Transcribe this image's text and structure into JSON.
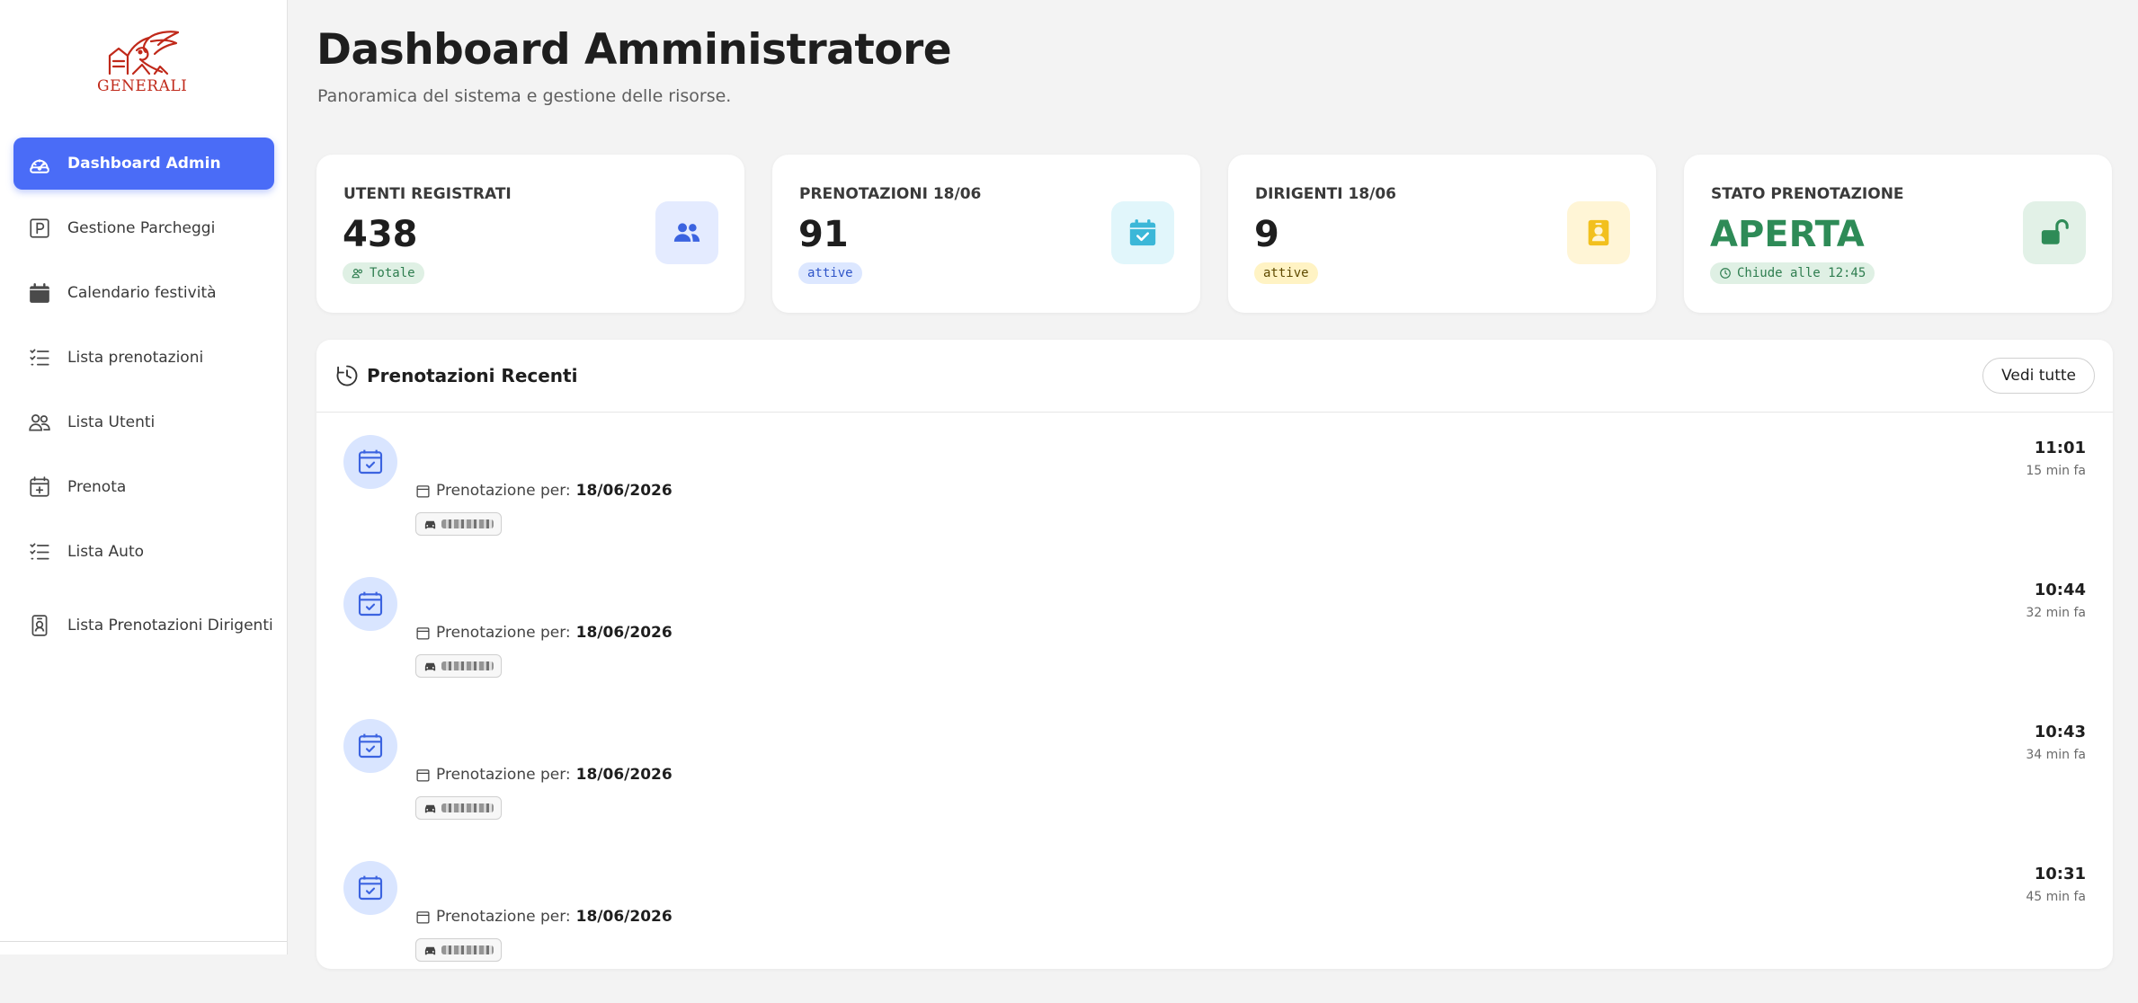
{
  "brand": {
    "logo_text": "GENERALI",
    "color": "#c0291a"
  },
  "sidebar": {
    "items": [
      {
        "label": "Dashboard Admin",
        "icon": "speedometer-icon",
        "active": true
      },
      {
        "label": "Gestione Parcheggi",
        "icon": "parking-icon",
        "active": false
      },
      {
        "label": "Calendario festività",
        "icon": "calendar-icon",
        "active": false
      },
      {
        "label": "Lista prenotazioni",
        "icon": "list-check-icon",
        "active": false
      },
      {
        "label": "Lista Utenti",
        "icon": "users-icon",
        "active": false
      },
      {
        "label": "Prenota",
        "icon": "calendar-plus-icon",
        "active": false
      },
      {
        "label": "Lista Auto",
        "icon": "list-check-icon",
        "active": false
      },
      {
        "label": "Lista Prenotazioni Dirigenti",
        "icon": "person-badge-icon",
        "active": false
      }
    ]
  },
  "header": {
    "title": "Dashboard Amministratore",
    "subtitle": "Panoramica del sistema e gestione delle risorse."
  },
  "cards": [
    {
      "label": "UTENTI REGISTRATI",
      "value": "438",
      "badge": "Totale",
      "icon": "people-icon"
    },
    {
      "label": "PRENOTAZIONI 18/06",
      "value": "91",
      "badge": "attive",
      "icon": "calendar-check-icon"
    },
    {
      "label": "DIRIGENTI 18/06",
      "value": "9",
      "badge": "attive",
      "icon": "person-badge-icon"
    },
    {
      "label": "STATO PRENOTAZIONE",
      "value": "APERTA",
      "badge": "Chiude alle 12:45",
      "icon": "unlock-icon"
    }
  ],
  "recent": {
    "title": "Prenotazioni Recenti",
    "view_all": "Vedi tutte",
    "label": "Prenotazione per:",
    "items": [
      {
        "date": "18/06/2026",
        "time": "11:01",
        "ago": "15 min fa"
      },
      {
        "date": "18/06/2026",
        "time": "10:44",
        "ago": "32 min fa"
      },
      {
        "date": "18/06/2026",
        "time": "10:43",
        "ago": "34 min fa"
      },
      {
        "date": "18/06/2026",
        "time": "10:31",
        "ago": "45 min fa"
      }
    ]
  },
  "colors": {
    "primary": "#4a6cf7",
    "success": "#2e8b57",
    "info": "#3bb7d8",
    "warning": "#f2c01e"
  }
}
